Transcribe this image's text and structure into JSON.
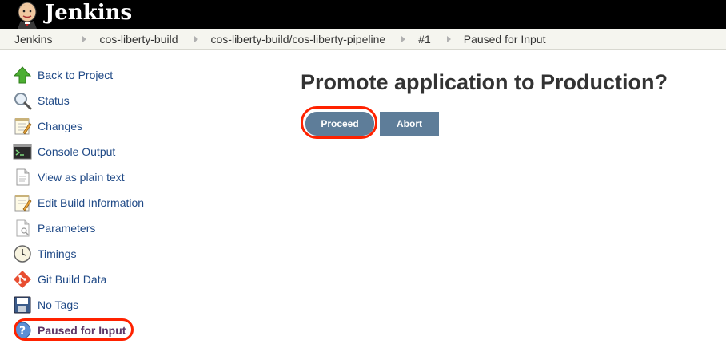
{
  "header": {
    "brand": "Jenkins",
    "logo_icon": "jenkins-butler-icon"
  },
  "breadcrumb": {
    "items": [
      "Jenkins",
      "cos-liberty-build",
      "cos-liberty-build/cos-liberty-pipeline",
      "#1",
      "Paused for Input"
    ]
  },
  "sidebar": {
    "items": [
      {
        "label": "Back to Project",
        "icon": "up-arrow-icon"
      },
      {
        "label": "Status",
        "icon": "magnifier-icon"
      },
      {
        "label": "Changes",
        "icon": "notepad-icon"
      },
      {
        "label": "Console Output",
        "icon": "terminal-icon"
      },
      {
        "label": "View as plain text",
        "icon": "document-icon"
      },
      {
        "label": "Edit Build Information",
        "icon": "notepad-edit-icon"
      },
      {
        "label": "Parameters",
        "icon": "document-search-icon"
      },
      {
        "label": "Timings",
        "icon": "clock-icon"
      },
      {
        "label": "Git Build Data",
        "icon": "git-icon"
      },
      {
        "label": "No Tags",
        "icon": "save-icon"
      },
      {
        "label": "Paused for Input",
        "icon": "help-icon"
      }
    ]
  },
  "main": {
    "title": "Promote application to Production?",
    "proceed_label": "Proceed",
    "abort_label": "Abort"
  },
  "colors": {
    "header_bg": "#000000",
    "button_bg": "#5e7d99",
    "link": "#204a87",
    "annotation": "#ff2200"
  }
}
